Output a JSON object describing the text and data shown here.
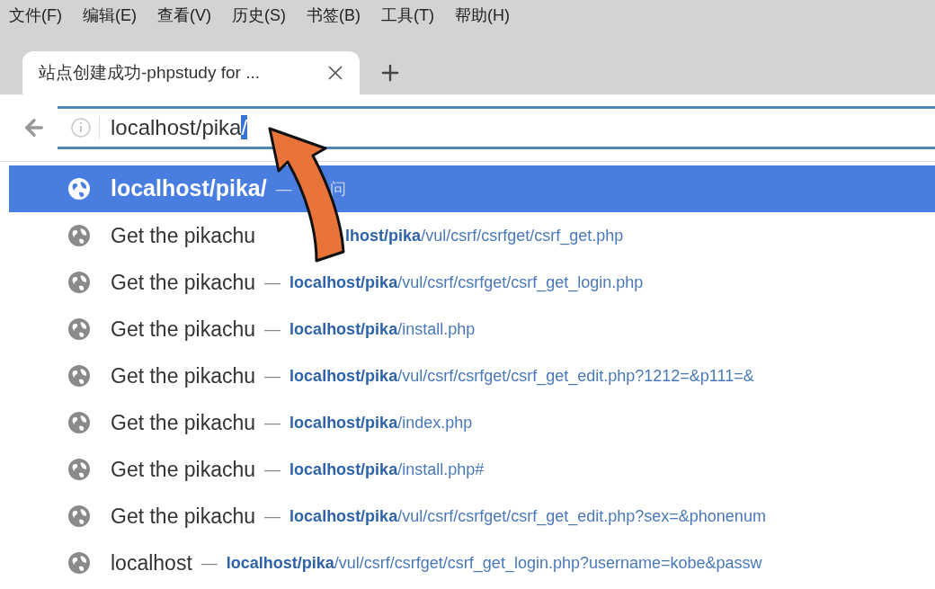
{
  "menu": [
    {
      "label": "文件(F)"
    },
    {
      "label": "编辑(E)"
    },
    {
      "label": "查看(V)"
    },
    {
      "label": "历史(S)"
    },
    {
      "label": "书签(B)"
    },
    {
      "label": "工具(T)"
    },
    {
      "label": "帮助(H)"
    }
  ],
  "tabs": [
    {
      "title": "站点创建成功-phpstudy for ...",
      "selected": true
    }
  ],
  "address": {
    "typed": "localhost/pika",
    "autofill": "/"
  },
  "suggestions": [
    {
      "title": "localhost/pika/",
      "separator": "—",
      "action": "问",
      "selected": true
    },
    {
      "title": "Get the pikachu",
      "host": "lhost/pika",
      "path": "/vul/csrf/csrfget/csrf_get.php",
      "selected": false
    },
    {
      "title": "Get the pikachu",
      "separator": "—",
      "host": "localhost/pika",
      "path": "/vul/csrf/csrfget/csrf_get_login.php",
      "selected": false
    },
    {
      "title": "Get the pikachu",
      "separator": "—",
      "host": "localhost/pika",
      "path": "/install.php",
      "selected": false
    },
    {
      "title": "Get the pikachu",
      "separator": "—",
      "host": "localhost/pika",
      "path": "/vul/csrf/csrfget/csrf_get_edit.php?1212=&p111=&",
      "selected": false
    },
    {
      "title": "Get the pikachu",
      "separator": "—",
      "host": "localhost/pika",
      "path": "/index.php",
      "selected": false
    },
    {
      "title": "Get the pikachu",
      "separator": "—",
      "host": "localhost/pika",
      "path": "/install.php#",
      "selected": false
    },
    {
      "title": "Get the pikachu",
      "separator": "—",
      "host": "localhost/pika",
      "path": "/vul/csrf/csrfget/csrf_get_edit.php?sex=&phonenum",
      "selected": false
    },
    {
      "title": "localhost",
      "separator": "—",
      "host": "localhost/pika",
      "path": "/vul/csrf/csrfget/csrf_get_login.php?username=kobe&passw",
      "selected": false
    }
  ]
}
